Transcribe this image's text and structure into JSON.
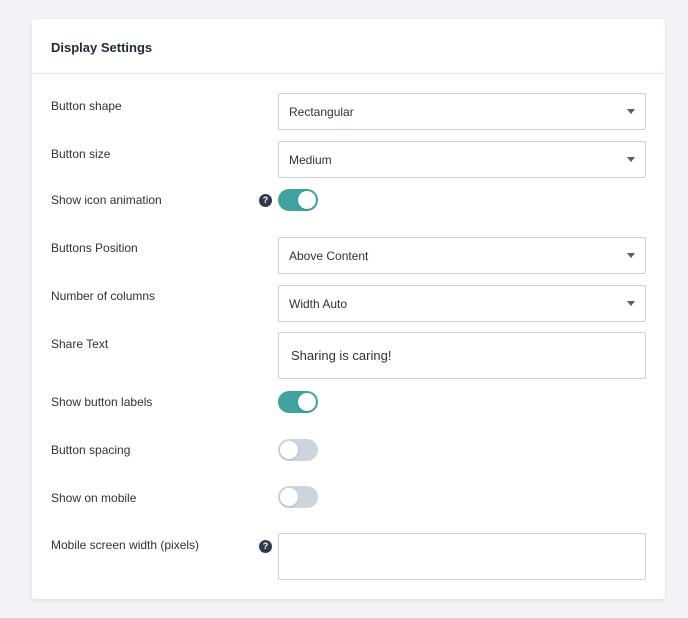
{
  "panel": {
    "title": "Display Settings"
  },
  "colors": {
    "accent": "#3fa3a0",
    "toggle_off": "#ccd5de",
    "help_icon": "#2e3b4e"
  },
  "settings": {
    "button_shape": {
      "label": "Button shape",
      "value": "Rectangular"
    },
    "button_size": {
      "label": "Button size",
      "value": "Medium"
    },
    "show_icon_animation": {
      "label": "Show icon animation",
      "help": "?",
      "enabled": true
    },
    "buttons_position": {
      "label": "Buttons Position",
      "value": "Above Content"
    },
    "number_of_columns": {
      "label": "Number of columns",
      "value": "Width Auto"
    },
    "share_text": {
      "label": "Share Text",
      "value": "Sharing is caring!"
    },
    "show_button_labels": {
      "label": "Show button labels",
      "enabled": true
    },
    "button_spacing": {
      "label": "Button spacing",
      "enabled": false
    },
    "show_on_mobile": {
      "label": "Show on mobile",
      "enabled": false
    },
    "mobile_screen_width": {
      "label": "Mobile screen width (pixels)",
      "help": "?",
      "value": ""
    }
  }
}
